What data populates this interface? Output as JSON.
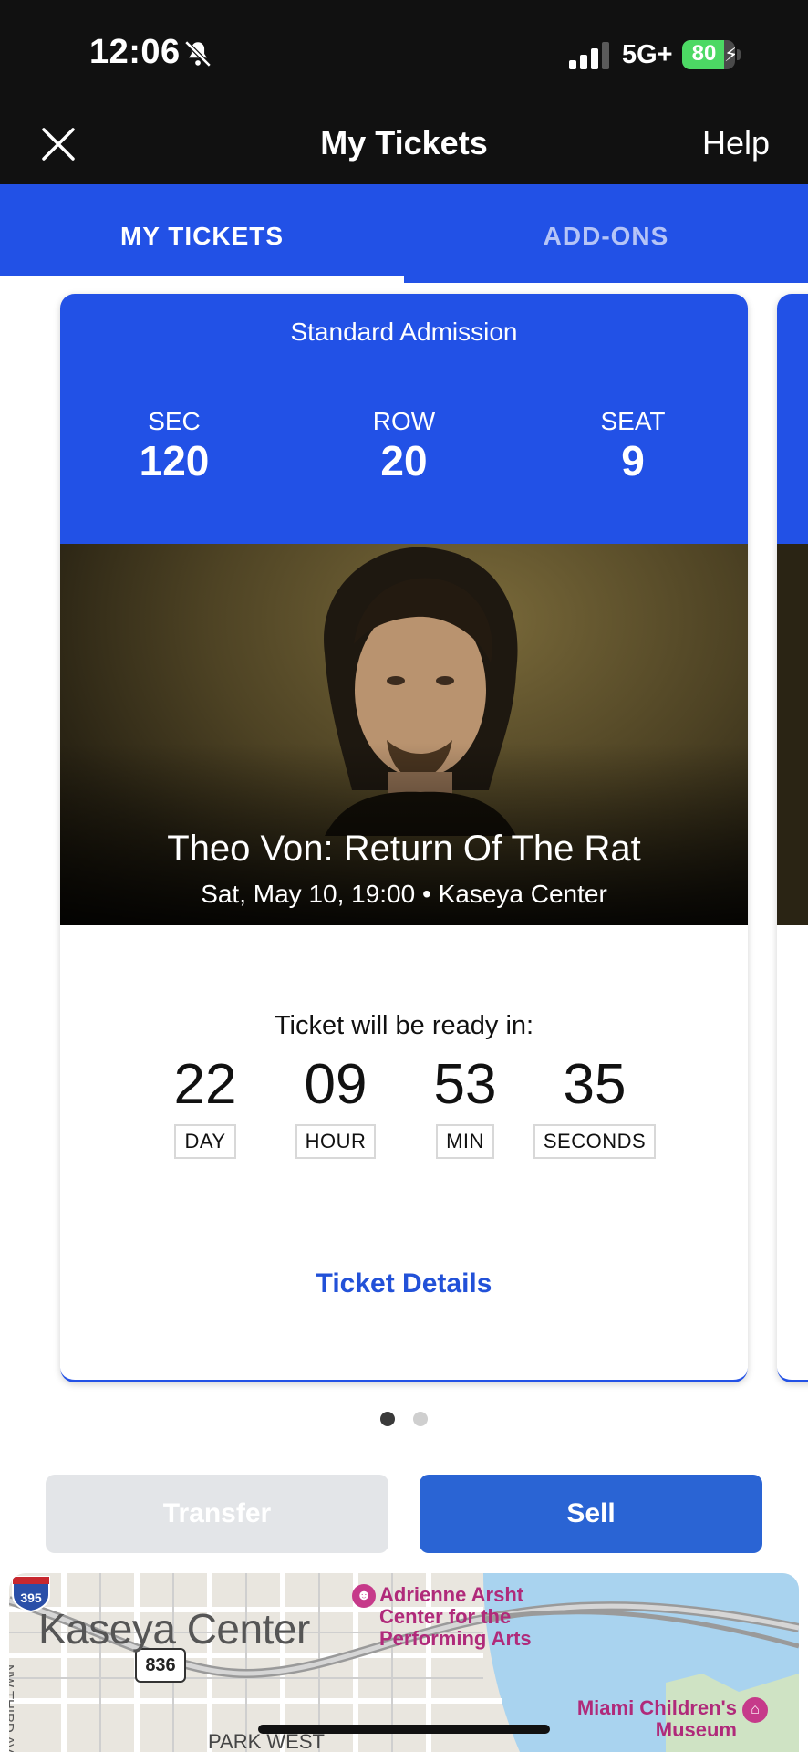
{
  "status_bar": {
    "time": "12:06",
    "network": "5G+",
    "battery_level": "80",
    "battery_percent": 80,
    "icons": [
      "bell-slash-icon",
      "signal-icon",
      "battery-charging-icon"
    ]
  },
  "nav": {
    "title": "My Tickets",
    "help": "Help",
    "close_icon": "close-icon"
  },
  "tabs": [
    {
      "label": "MY TICKETS",
      "active": true
    },
    {
      "label": "ADD-ONS",
      "active": false
    }
  ],
  "ticket": {
    "admission": "Standard Admission",
    "sec_label": "SEC",
    "sec": "120",
    "row_label": "ROW",
    "row": "20",
    "seat_label": "SEAT",
    "seat": "9",
    "event_title": "Theo Von: Return Of The Rat",
    "event_subtitle": "Sat, May 10, 19:00 • Kaseya Center",
    "ready_label": "Ticket will be ready in:",
    "countdown": {
      "day": "22",
      "day_label": "DAY",
      "hour": "09",
      "hour_label": "HOUR",
      "min": "53",
      "min_label": "MIN",
      "sec": "35",
      "sec_label": "SECONDS"
    },
    "details_link": "Ticket Details"
  },
  "pager": {
    "count": 2,
    "active_index": 0
  },
  "actions": {
    "transfer": "Transfer",
    "sell": "Sell"
  },
  "map": {
    "venue": "Kaseya Center",
    "poi_1": "Adrienne Arsht Center for the Performing Arts",
    "poi_2": "Miami Children's Museum",
    "street_1": "NW THIRD AVE",
    "street_2": "PARK WEST",
    "route": "836",
    "interstate": "395",
    "colors": {
      "water": "#a9d3ef",
      "land": "#e9e6df",
      "poi": "#b02a7a"
    }
  },
  "colors": {
    "brand_blue": "#2251e6",
    "button_blue": "#2a64d4",
    "header_black": "#111111"
  }
}
